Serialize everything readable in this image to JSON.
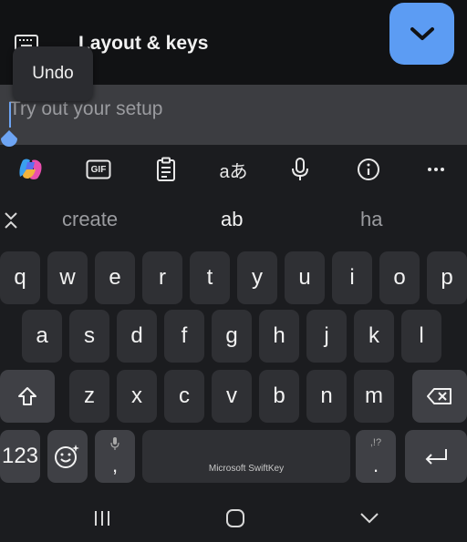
{
  "header": {
    "title": "Layout & keys",
    "tooltip": "Undo",
    "icons": {
      "keyboard": "keyboard-icon",
      "collapse": "chevron-down-icon"
    },
    "accent_color": "#5c9cf3"
  },
  "input": {
    "value": "",
    "placeholder": "Try out your setup"
  },
  "toolbar": {
    "icons": [
      "copilot-icon",
      "gif-icon",
      "clipboard-icon",
      "translate-icon",
      "microphone-icon",
      "info-icon",
      "more-icon"
    ],
    "gif_label": "GIF",
    "translate_label": "aあ"
  },
  "suggestions": [
    "create",
    "ab",
    "ha"
  ],
  "keyboard": {
    "row1": [
      "q",
      "w",
      "e",
      "r",
      "t",
      "y",
      "u",
      "i",
      "o",
      "p"
    ],
    "row2": [
      "a",
      "s",
      "d",
      "f",
      "g",
      "h",
      "j",
      "k",
      "l"
    ],
    "row3": [
      "z",
      "x",
      "c",
      "v",
      "b",
      "n",
      "m"
    ],
    "numbers_label": "123",
    "comma": ",",
    "period": ".",
    "period_hint": ",!?",
    "space_label": "Microsoft SwiftKey"
  },
  "navbar": {
    "icons": [
      "recents-icon",
      "home-icon",
      "back-icon"
    ]
  }
}
